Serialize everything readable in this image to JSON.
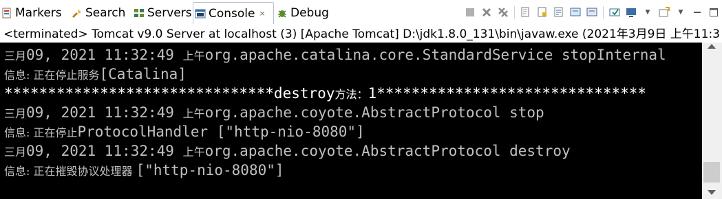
{
  "tabs": [
    {
      "label": "Markers",
      "icon": "markers-icon"
    },
    {
      "label": "Search",
      "icon": "search-icon"
    },
    {
      "label": "Servers",
      "icon": "servers-icon"
    },
    {
      "label": "Console",
      "icon": "console-icon",
      "active": true,
      "close": "×"
    },
    {
      "label": "Debug",
      "icon": "debug-icon"
    }
  ],
  "toolbar": {
    "icons": [
      "terminate-icon",
      "remove-launch-icon",
      "remove-all-terminated-icon",
      "clear-console-icon",
      "scroll-lock-icon",
      "word-wrap-icon",
      "show-on-stdout-icon",
      "show-on-stderr-icon",
      "pin-console-icon",
      "display-selected-console-icon",
      "open-console-icon",
      "minimize-icon",
      "maximize-icon"
    ]
  },
  "status": "<terminated> Tomcat v9.0 Server at localhost (3) [Apache Tomcat] D:\\jdk1.8.0_131\\bin\\javaw.exe (2021年3月9日 上午11:3",
  "console": {
    "lines": [
      {
        "segments": [
          {
            "t": "三月",
            "c": "cjk"
          },
          {
            "t": "09, 2021 11:32:49 ",
            "c": "mono"
          },
          {
            "t": "上午",
            "c": "cjk"
          },
          {
            "t": "org.apache.catalina.core.StandardService stopInternal",
            "c": "mono"
          }
        ],
        "color": "gray"
      },
      {
        "segments": [
          {
            "t": "信息: 正在停止服务",
            "c": "cjk"
          },
          {
            "t": "[Catalina]",
            "c": "mono"
          }
        ],
        "color": "gray"
      },
      {
        "segments": [
          {
            "t": "*******************************destroy",
            "c": "mono"
          },
          {
            "t": "方法：",
            "c": "cjk"
          },
          {
            "t": "1*******************************",
            "c": "mono"
          }
        ],
        "color": "white"
      },
      {
        "segments": [
          {
            "t": "三月",
            "c": "cjk"
          },
          {
            "t": "09, 2021 11:32:49 ",
            "c": "mono"
          },
          {
            "t": "上午",
            "c": "cjk"
          },
          {
            "t": "org.apache.coyote.AbstractProtocol stop",
            "c": "mono"
          }
        ],
        "color": "gray"
      },
      {
        "segments": [
          {
            "t": "信息: 正在停止",
            "c": "cjk"
          },
          {
            "t": "ProtocolHandler [\"http-nio-8080\"]",
            "c": "mono"
          }
        ],
        "color": "gray"
      },
      {
        "segments": [
          {
            "t": "三月",
            "c": "cjk"
          },
          {
            "t": "09, 2021 11:32:49 ",
            "c": "mono"
          },
          {
            "t": "上午",
            "c": "cjk"
          },
          {
            "t": "org.apache.coyote.AbstractProtocol destroy",
            "c": "mono"
          }
        ],
        "color": "gray"
      },
      {
        "segments": [
          {
            "t": "信息: 正在摧毁协议处理器 ",
            "c": "cjk"
          },
          {
            "t": "[\"http-nio-8080\"]",
            "c": "mono"
          }
        ],
        "color": "gray"
      }
    ]
  },
  "colors": {
    "console_bg": "#000000",
    "log_text": "#c0c0c0",
    "stdout_text": "#ffffff",
    "tab_border": "#b9c3d0"
  }
}
